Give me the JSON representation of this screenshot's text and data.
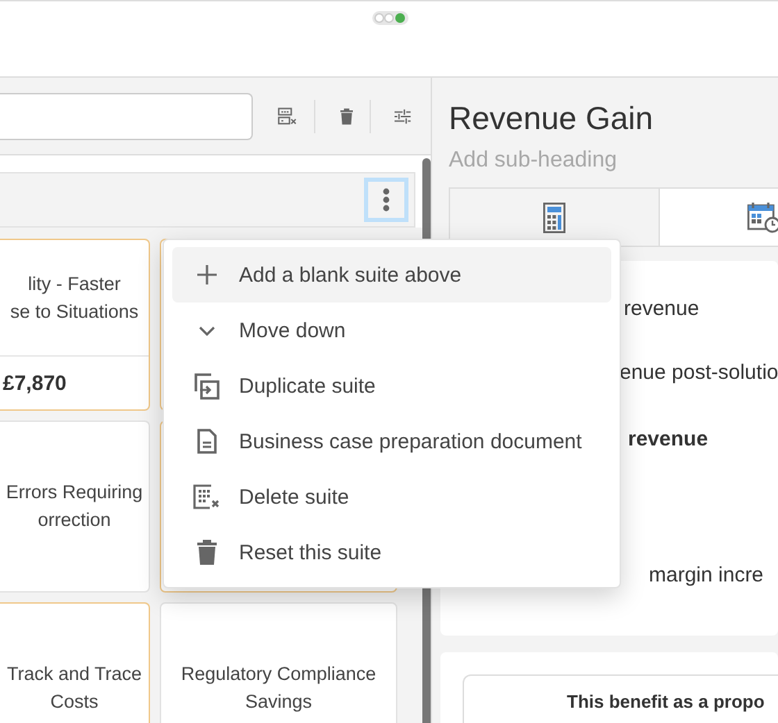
{
  "suite_header": {
    "menu_button_focused": true
  },
  "tiles": [
    {
      "title": "lity - Faster\nse to Situations",
      "value": "£7,870",
      "selected": true
    },
    {
      "selected": true
    },
    {
      "title": "Errors Requiring\norrection",
      "selected": false
    },
    {
      "selected": true
    },
    {
      "title": "Track and Trace\nCosts",
      "selected": true
    },
    {
      "title": "Regulatory Compliance\nSavings",
      "selected": false
    }
  ],
  "menu": {
    "items": [
      {
        "kind": "plus",
        "label": "Add a blank suite above",
        "selected": true
      },
      {
        "kind": "chevron",
        "label": "Move down",
        "selected": false
      },
      {
        "kind": "duplicate",
        "label": "Duplicate suite",
        "selected": false
      },
      {
        "kind": "document",
        "label": "Business case preparation document",
        "selected": false
      },
      {
        "kind": "grid-delete",
        "label": "Delete suite",
        "selected": false
      },
      {
        "kind": "trash",
        "label": "Reset this suite",
        "selected": false
      }
    ]
  },
  "detail": {
    "title": "Revenue Gain",
    "subheading": {
      "placeholder": "Add sub-heading"
    },
    "tabs": [
      {
        "kind": "calculator",
        "selected": false
      },
      {
        "kind": "calendar",
        "selected": true
      }
    ],
    "lines": [
      {
        "text": "revenue",
        "bold": false
      },
      {
        "text": "enue post-solutio",
        "bold": false
      },
      {
        "text": "revenue",
        "bold": true
      },
      {
        "text": "margin incre",
        "bold": false
      }
    ],
    "benefit": "This benefit as a propo"
  }
}
